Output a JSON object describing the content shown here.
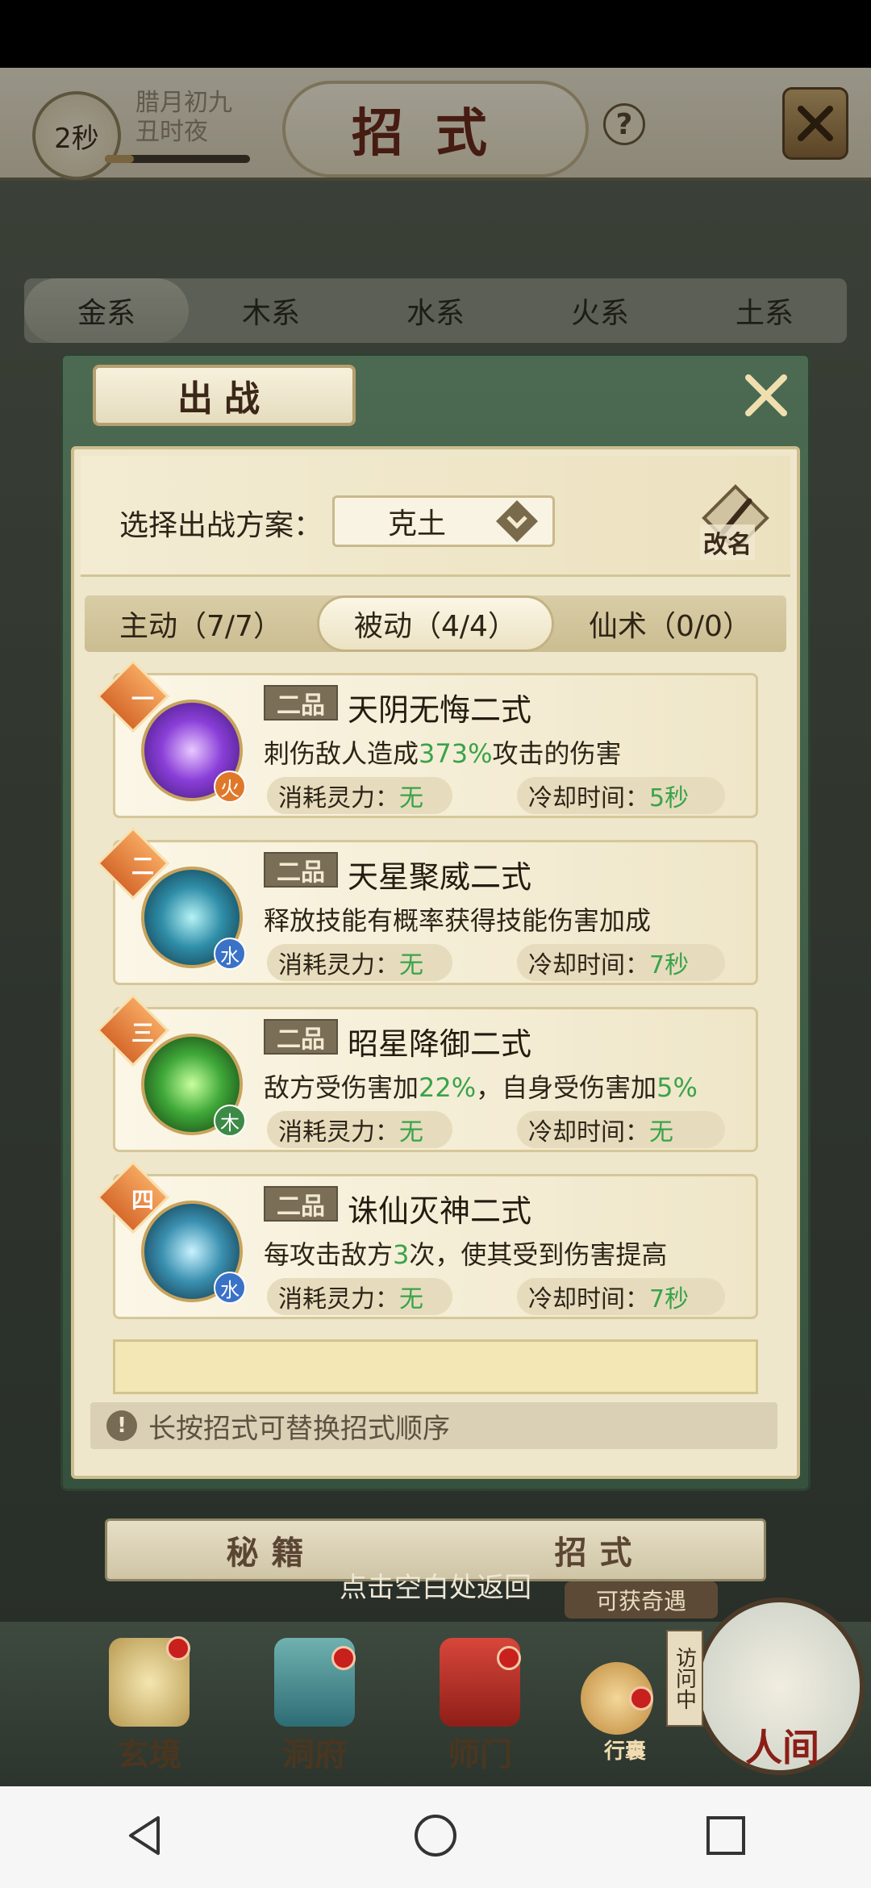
{
  "header": {
    "timer": "2秒",
    "date_line1": "腊月初九",
    "date_line2": "丑时夜",
    "title": "招式"
  },
  "progress": {
    "fraction": 0.2
  },
  "element_tabs": [
    "金系",
    "木系",
    "水系",
    "火系",
    "土系"
  ],
  "modal": {
    "title": "出战",
    "plan_label": "选择出战方案：",
    "plan_value": "克土",
    "rename_label": "改名",
    "sub_tabs": [
      "主动（7/7）",
      "被动（4/4）",
      "仙术（0/0）"
    ],
    "active_sub_tab": 1,
    "skills": [
      {
        "rank": "一",
        "grade": "二品",
        "name": "天阴无悔二式",
        "desc_pre": "刺伤敌人造成",
        "desc_hl": "373%",
        "desc_post": "攻击的伤害",
        "desc_hl2": "",
        "desc_post2": "",
        "element": "火",
        "element_color": "#e0782a",
        "cost_label": "消耗灵力：",
        "cost_value": "无",
        "cd_label": "冷却时间：",
        "cd_value": "5秒"
      },
      {
        "rank": "二",
        "grade": "二品",
        "name": "天星聚威二式",
        "desc_pre": "释放技能有概率获得技能伤害加成",
        "desc_hl": "",
        "desc_post": "",
        "desc_hl2": "",
        "desc_post2": "",
        "element": "水",
        "element_color": "#3a72c8",
        "cost_label": "消耗灵力：",
        "cost_value": "无",
        "cd_label": "冷却时间：",
        "cd_value": "7秒"
      },
      {
        "rank": "三",
        "grade": "二品",
        "name": "昭星降御二式",
        "desc_pre": "敌方受伤害加",
        "desc_hl": "22%",
        "desc_post": "，自身受伤害加",
        "desc_hl2": "5%",
        "desc_post2": "",
        "element": "木",
        "element_color": "#3c8a46",
        "cost_label": "消耗灵力：",
        "cost_value": "无",
        "cd_label": "冷却时间：",
        "cd_value": "无"
      },
      {
        "rank": "四",
        "grade": "二品",
        "name": "诛仙灭神二式",
        "desc_pre": "每攻击敌方",
        "desc_hl": "3",
        "desc_post": "次，使其受到伤害提高",
        "desc_hl2": "",
        "desc_post2": "",
        "element": "水",
        "element_color": "#3a72c8",
        "cost_label": "消耗灵力：",
        "cost_value": "无",
        "cd_label": "冷却时间：",
        "cd_value": "7秒"
      }
    ],
    "hint": "长按招式可替换招式顺序"
  },
  "bottom_tabs": [
    "秘籍",
    "招式"
  ],
  "return_hint": "点击空白处返回",
  "adventure_tag": "可获奇遇",
  "nav": {
    "items": [
      "玄境",
      "洞府",
      "师门",
      "行囊"
    ],
    "visit": "访问中",
    "renjian": "人间"
  },
  "colors": {
    "accent_green": "#3aa34a",
    "panel_green": "#36523e",
    "red_dot": "#c8201c"
  }
}
